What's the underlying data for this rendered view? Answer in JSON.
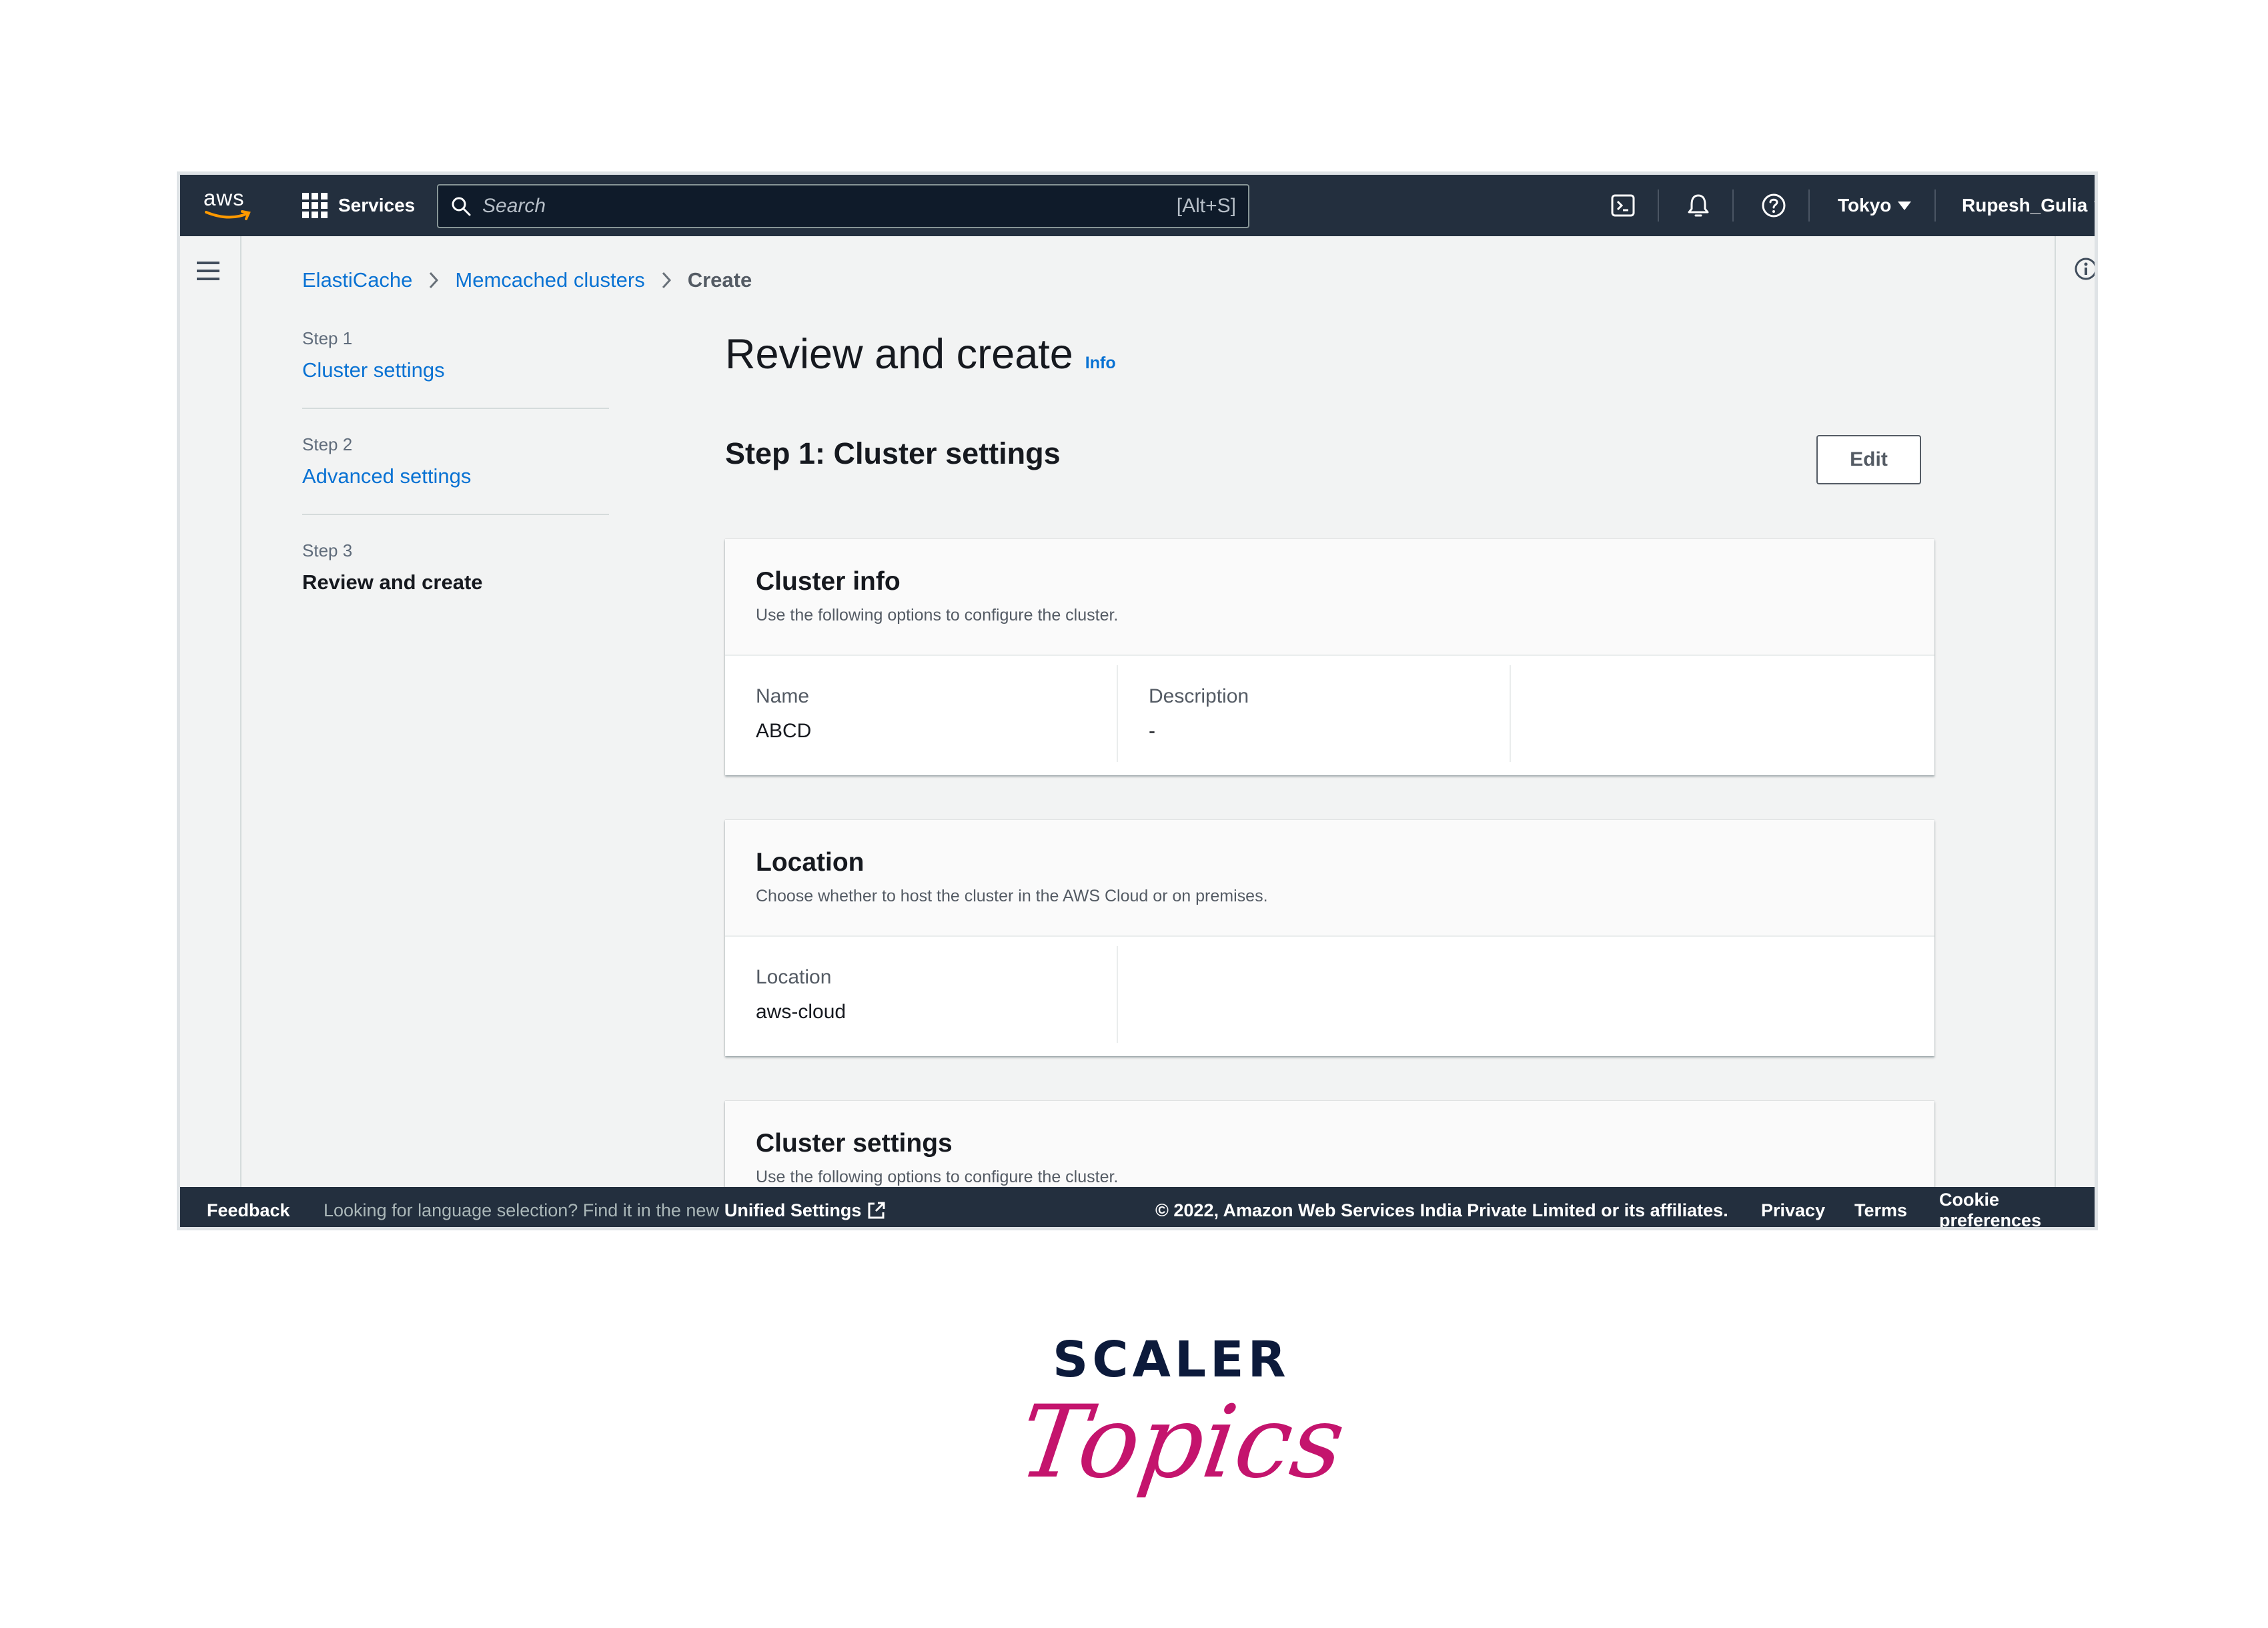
{
  "topnav": {
    "logo_text": "aws",
    "services_label": "Services",
    "search": {
      "placeholder": "Search",
      "value": "",
      "shortcut": "[Alt+S]"
    },
    "region": "Tokyo",
    "user": "Rupesh_Gulia",
    "icons": [
      "cloudshell-icon",
      "bell-icon",
      "help-icon"
    ]
  },
  "breadcrumb": {
    "items": [
      {
        "label": "ElastiCache"
      },
      {
        "label": "Memcached clusters"
      },
      {
        "label": "Create"
      }
    ]
  },
  "steps": [
    {
      "num": "Step 1",
      "label": "Cluster settings",
      "state": "link"
    },
    {
      "num": "Step 2",
      "label": "Advanced settings",
      "state": "link"
    },
    {
      "num": "Step 3",
      "label": "Review and create",
      "state": "current"
    }
  ],
  "main": {
    "title": "Review and create",
    "info_link": "Info",
    "section_title": "Step 1: Cluster settings",
    "edit_label": "Edit",
    "cards": [
      {
        "title": "Cluster info",
        "description": "Use the following options to configure the cluster.",
        "fields": [
          {
            "label": "Name",
            "value": "ABCD"
          },
          {
            "label": "Description",
            "value": "-"
          }
        ]
      },
      {
        "title": "Location",
        "description": "Choose whether to host the cluster in the AWS Cloud or on premises.",
        "fields": [
          {
            "label": "Location",
            "value": "aws-cloud"
          }
        ]
      },
      {
        "title": "Cluster settings",
        "description": "Use the following options to configure the cluster."
      }
    ]
  },
  "footer": {
    "feedback": "Feedback",
    "language_text": "Looking for language selection? Find it in the new",
    "unified_settings": "Unified Settings",
    "copyright": "© 2022, Amazon Web Services India Private Limited or its affiliates.",
    "privacy": "Privacy",
    "terms": "Terms",
    "cookie": "Cookie preferences"
  },
  "brand": {
    "line1": "SCALER",
    "line2": "Topics"
  },
  "colors": {
    "nav_bg": "#232f3e",
    "link": "#0972d3",
    "brand_navy": "#0c1a3b",
    "brand_pink": "#c4146d"
  }
}
